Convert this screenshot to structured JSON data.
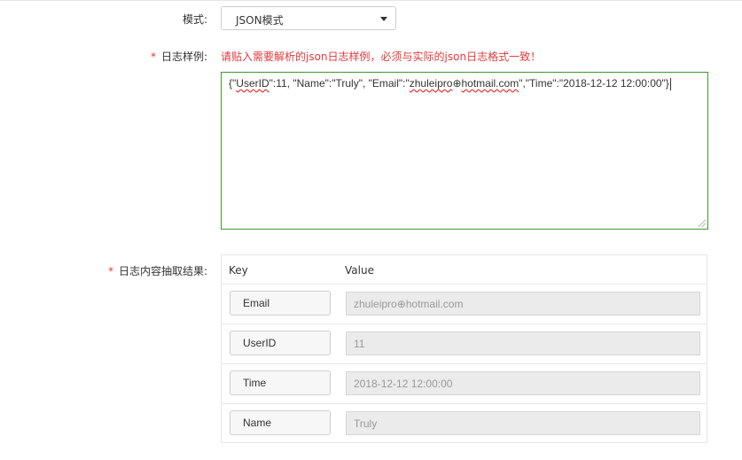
{
  "form": {
    "mode_label": "模式:",
    "mode_value": "JSON模式",
    "sample_label": "日志样例:",
    "sample_required": "*",
    "sample_hint": "请贴入需要解析的json日志样例，必须与实际的json日志格式一致！",
    "sample_text": {
      "p1": "{\"",
      "p2": "UserID",
      "p3": "\":11, \"Name\":\"Truly\", \"Email\":\"",
      "p4": "zhuleipro",
      "p5": "⊕",
      "p6": "hotmail.com",
      "p7": "\",\"Time\":\"2018-12-12 12:00:00\"}"
    },
    "result_label": "日志内容抽取结果:",
    "result_required": "*"
  },
  "result_table": {
    "key_header": "Key",
    "value_header": "Value",
    "rows": [
      {
        "key": "Email",
        "value": "zhuleipro⊕hotmail.com"
      },
      {
        "key": "UserID",
        "value": "11"
      },
      {
        "key": "Time",
        "value": "2018-12-12 12:00:00"
      },
      {
        "key": "Name",
        "value": "Truly"
      }
    ]
  },
  "colors": {
    "required": "#e4393c",
    "focus_border": "#3a9a2a"
  }
}
